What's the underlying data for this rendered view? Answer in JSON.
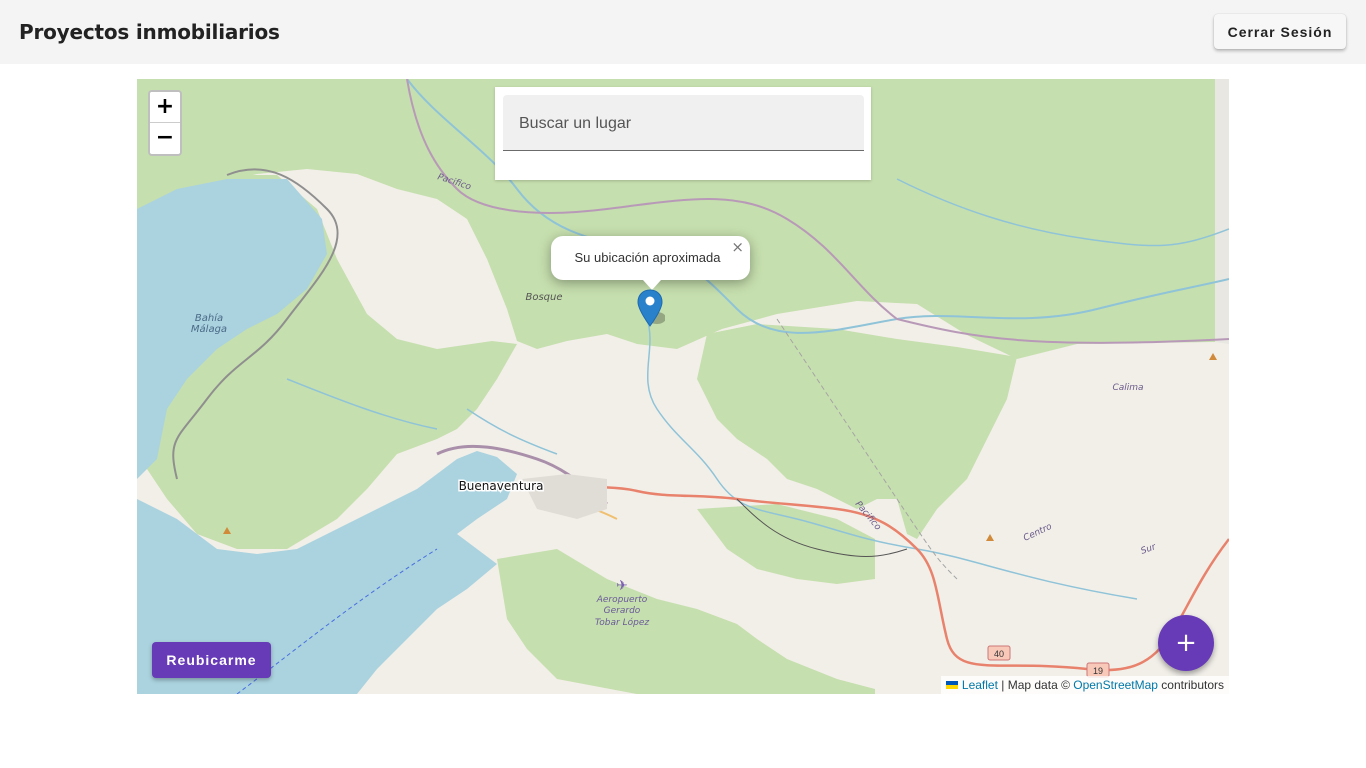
{
  "header": {
    "title": "Proyectos inmobiliarios",
    "logout_label": "Cerrar Sesión"
  },
  "map": {
    "zoom_in_label": "+",
    "zoom_out_label": "−",
    "search": {
      "placeholder": "Buscar un lugar",
      "value": ""
    },
    "popup": {
      "text": "Su ubicación aproximada",
      "close_label": "×"
    },
    "marker_icon": "map-pin-icon",
    "relocate_label": "Reubicarme",
    "fab_label": "+",
    "labels": {
      "bahia": [
        "Bahía",
        "Málaga"
      ],
      "bosque": "Bosque",
      "pacifico_top": "Pacifico",
      "pacifico_right": "Pacifico",
      "buenaventura": "Buenaventura",
      "aeropuerto": [
        "Aeropuerto",
        "Gerardo",
        "Tobar López"
      ],
      "calima": "Calima",
      "centro": "Centro",
      "sur": "Sur",
      "road_40": "40",
      "road_19": "19"
    },
    "attribution": {
      "leaflet": "Leaflet",
      "separator": " | Map data © ",
      "osm": "OpenStreetMap",
      "suffix": " contributors"
    },
    "colors": {
      "land": "#f2efe9",
      "water": "#aad3df",
      "forest": "#c1dcaa",
      "accent": "#673ab7",
      "road_primary": "#e8826c"
    }
  }
}
